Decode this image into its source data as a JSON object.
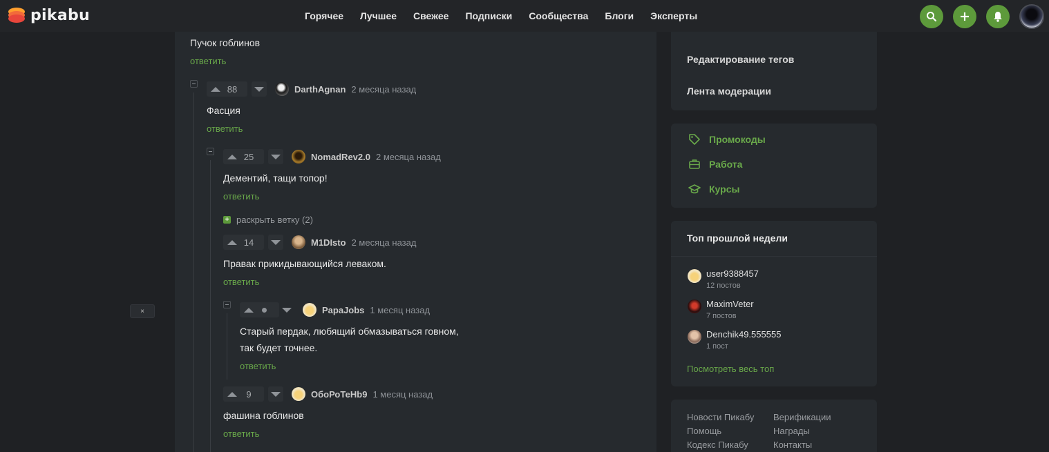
{
  "header": {
    "logo_text": "pikabu",
    "nav": [
      "Горячее",
      "Лучшее",
      "Свежее",
      "Подписки",
      "Сообщества",
      "Блоги",
      "Эксперты"
    ],
    "icons": [
      "search-icon",
      "plus-icon",
      "bell-icon",
      "user-avatar"
    ]
  },
  "left_panel": {
    "close_label": "×"
  },
  "comments": {
    "c0": {
      "text": "Пучок гоблинов",
      "reply": "ответить"
    },
    "c1": {
      "score": "88",
      "user": "DarthAgnan",
      "time": "2 месяца назад",
      "text": "Фасция",
      "reply": "ответить"
    },
    "c2": {
      "score": "25",
      "user": "NomadRev2.0",
      "time": "2 месяца назад",
      "text": "Дементий, тащи топор!",
      "reply": "ответить"
    },
    "expand": {
      "label": "раскрыть ветку (2)"
    },
    "c3": {
      "score": "14",
      "user": "M1DIsto",
      "time": "2 месяца назад",
      "text": "Правак прикидывающийся леваком.",
      "reply": "ответить"
    },
    "c4": {
      "user": "PapaJobs",
      "time": "1 месяц назад",
      "text_line1": "Старый пердак, любящий обмазываться говном,",
      "text_line2": "так будет точнее.",
      "reply": "ответить"
    },
    "c5": {
      "score": "9",
      "user": "ОбоРоТеНb9",
      "time": "1 месяц назад",
      "text": "фашина гоблинов",
      "reply": "ответить"
    }
  },
  "sidebar": {
    "moderation": {
      "edit_tags": "Редактирование тегов",
      "mod_feed": "Лента модерации"
    },
    "services": [
      {
        "label": "Промокоды",
        "icon": "tag-icon"
      },
      {
        "label": "Работа",
        "icon": "briefcase-icon"
      },
      {
        "label": "Курсы",
        "icon": "graduation-cap-icon"
      }
    ],
    "top": {
      "title": "Топ прошлой недели",
      "users": [
        {
          "name": "user9388457",
          "count": "12 постов"
        },
        {
          "name": "MaximVeter",
          "count": "7 постов"
        },
        {
          "name": "Denchik49.555555",
          "count": "1 пост"
        }
      ],
      "see_all": "Посмотреть весь топ"
    },
    "footer": {
      "col1": [
        "Новости Пикабу",
        "Помощь",
        "Кодекс Пикабу"
      ],
      "col2": [
        "Верификации",
        "Награды",
        "Контакты"
      ]
    }
  },
  "colors": {
    "accent": "#5d9a3b",
    "link": "#69a84a",
    "background": "#1f2124",
    "panel": "#262a2e"
  }
}
